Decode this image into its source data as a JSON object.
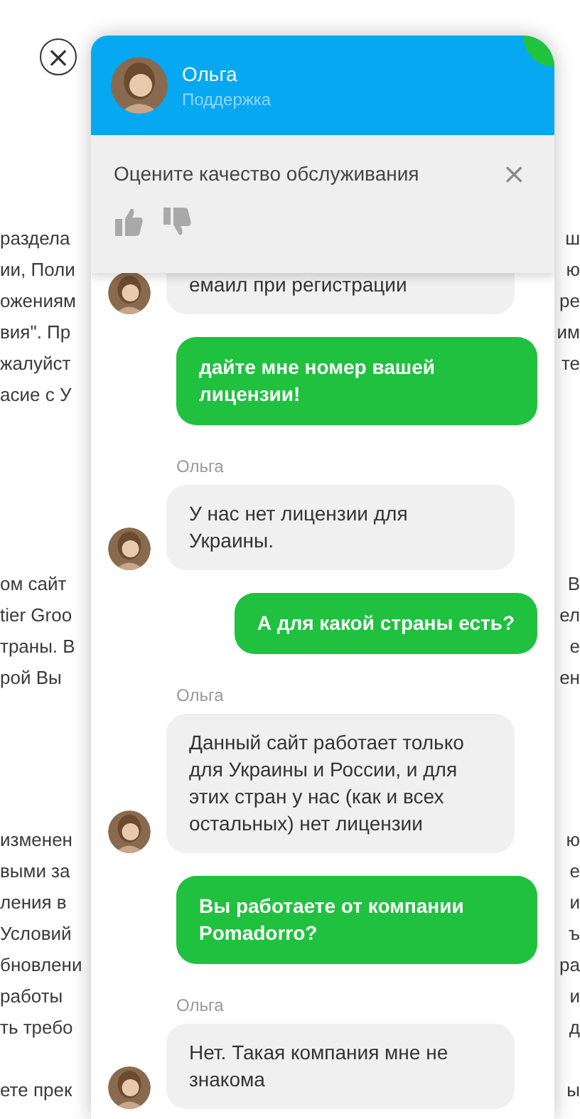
{
  "background_page": {
    "paragraphs": [
      {
        "lines": [
          {
            "left": "раздела",
            "right": "ш"
          },
          {
            "left": "ии, Поли",
            "right": "ю"
          },
          {
            "left": "ожениям",
            "right": "ре"
          },
          {
            "left": "вия\". Пр",
            "right": "им"
          },
          {
            "left": "жалуйст",
            "right": "те"
          },
          {
            "left": "асие с У"
          }
        ]
      },
      {
        "lines": [
          {
            "left": "ом сайт",
            "right": "В"
          },
          {
            "left": "tier Groo",
            "right": "ел"
          },
          {
            "left": "траны. В",
            "right": "е"
          },
          {
            "left": "рой Вы",
            "right": "ен"
          }
        ]
      },
      {
        "lines": [
          {
            "left": "изменен",
            "right": "ю"
          },
          {
            "left": "выми за",
            "right": "е"
          },
          {
            "left": "ления в",
            "right": "и"
          },
          {
            "left": "Условий",
            "right": "ъ"
          },
          {
            "left": "бновлени",
            "right": "ра"
          },
          {
            "left": "работы",
            "right": "и"
          },
          {
            "left": "ть требо",
            "right": "д"
          }
        ]
      },
      {
        "lines": [
          {
            "left": "ете прек",
            "right": "ы"
          }
        ]
      }
    ]
  },
  "close_button": {
    "label": "×"
  },
  "chat": {
    "agent": {
      "name": "Ольга",
      "role": "Поддержка",
      "online": true
    },
    "rating": {
      "prompt": "Оцените качество обслуживания",
      "dismiss": "×",
      "options": [
        {
          "kind": "up",
          "selected": false
        },
        {
          "kind": "down",
          "selected": false
        }
      ]
    },
    "messages": [
      {
        "kind": "incoming",
        "text": "емаил при регистрации"
      },
      {
        "kind": "outgoing",
        "text": "дайте мне номер вашей лицензии!"
      },
      {
        "kind": "incoming",
        "author": "Ольга",
        "text": "У нас нет лицензии для Украины."
      },
      {
        "kind": "outgoing",
        "text": "А для какой страны есть?"
      },
      {
        "kind": "incoming",
        "author": "Ольга",
        "text": "Данный сайт работает только для Украины и России, и для этих стран у нас (как и всех остальных) нет лицензии"
      },
      {
        "kind": "outgoing",
        "text": "Вы работаете от компании Pomadorro?"
      },
      {
        "kind": "incoming",
        "author": "Ольга",
        "text": "Нет. Такая компания мне не знакома"
      }
    ]
  }
}
